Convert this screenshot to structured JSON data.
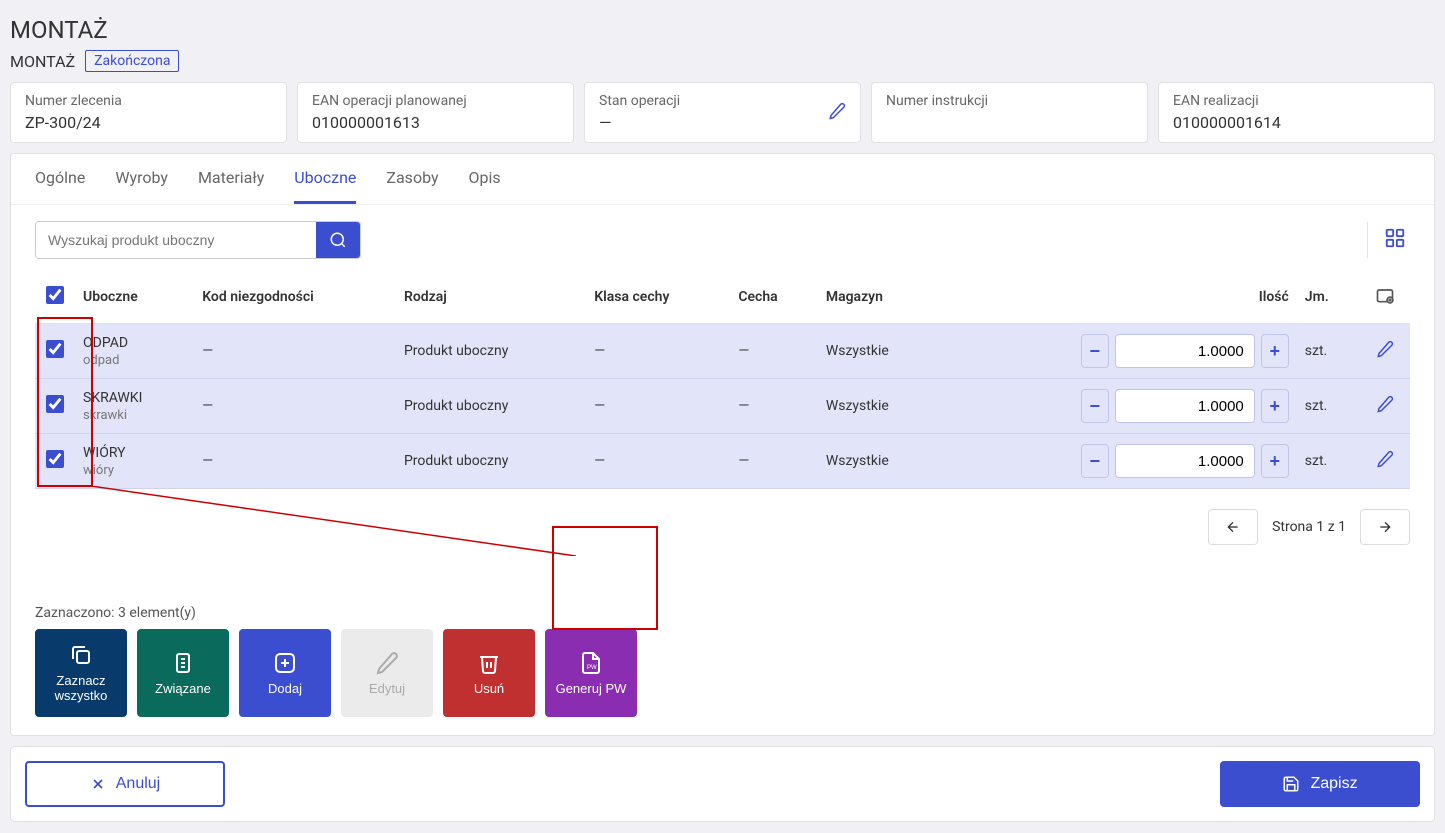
{
  "header": {
    "title": "MONTAŻ",
    "subtitle": "MONTAŻ",
    "badge": "Zakończona"
  },
  "info": {
    "order_no": {
      "label": "Numer zlecenia",
      "value": "ZP-300/24"
    },
    "ean_plan": {
      "label": "EAN operacji planowanej",
      "value": "010000001613"
    },
    "state": {
      "label": "Stan operacji",
      "value": "—"
    },
    "instruction": {
      "label": "Numer instrukcji",
      "value": ""
    },
    "ean_real": {
      "label": "EAN realizacji",
      "value": "010000001614"
    }
  },
  "tabs": [
    "Ogólne",
    "Wyroby",
    "Materiały",
    "Uboczne",
    "Zasoby",
    "Opis"
  ],
  "search": {
    "placeholder": "Wyszukaj produkt uboczny"
  },
  "columns": {
    "uboczne": "Uboczne",
    "kod": "Kod niezgodności",
    "rodzaj": "Rodzaj",
    "klasa": "Klasa cechy",
    "cecha": "Cecha",
    "magazyn": "Magazyn",
    "ilosc": "Ilość",
    "jm": "Jm."
  },
  "rows": [
    {
      "name": "ODPAD",
      "sub": "odpad",
      "kod": "—",
      "rodzaj": "Produkt uboczny",
      "klasa": "—",
      "cecha": "—",
      "magazyn": "Wszystkie",
      "ilosc": "1.0000",
      "jm": "szt."
    },
    {
      "name": "SKRAWKI",
      "sub": "skrawki",
      "kod": "—",
      "rodzaj": "Produkt uboczny",
      "klasa": "—",
      "cecha": "—",
      "magazyn": "Wszystkie",
      "ilosc": "1.0000",
      "jm": "szt."
    },
    {
      "name": "WIÓRY",
      "sub": "wióry",
      "kod": "—",
      "rodzaj": "Produkt uboczny",
      "klasa": "—",
      "cecha": "—",
      "magazyn": "Wszystkie",
      "ilosc": "1.0000",
      "jm": "szt."
    }
  ],
  "selected_text": "Zaznaczono: 3 element(y)",
  "actions": {
    "select_all": "Zaznacz wszystko",
    "related": "Związane",
    "add": "Dodaj",
    "edit": "Edytuj",
    "delete": "Usuń",
    "generate": "Generuj PW"
  },
  "pagination": {
    "text": "Strona 1 z 1"
  },
  "bottom": {
    "cancel": "Anuluj",
    "save": "Zapisz"
  }
}
